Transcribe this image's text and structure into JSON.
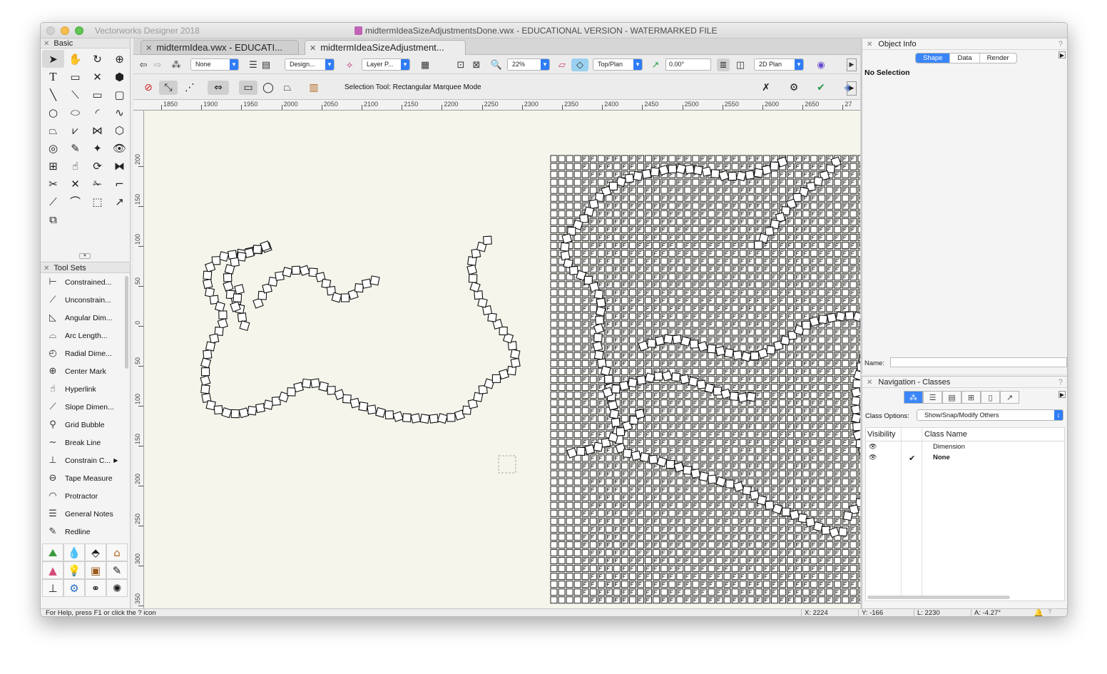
{
  "app": {
    "name": "Vectorworks Designer 2018",
    "document_title": "midtermIdeaSizeAdjustmentsDone.vwx - EDUCATIONAL VERSION - WATERMARKED FILE"
  },
  "tabs": [
    {
      "label": "midtermIdea.vwx - EDUCATI...",
      "active": false
    },
    {
      "label": "midtermIdeaSizeAdjustment...",
      "active": true
    }
  ],
  "basic_palette": {
    "title": "Basic",
    "tools": [
      "selection-icon",
      "pan-icon",
      "flyover-icon",
      "zoom-icon",
      "text-icon",
      "callout-icon",
      "locus-icon",
      "push-pull-icon",
      "line-icon",
      "double-line-icon",
      "rectangle-icon",
      "rounded-rectangle-icon",
      "circle-icon",
      "oval-icon",
      "arc-icon",
      "freehand-icon",
      "polygon-icon",
      "double-polygon-icon",
      "polyline-icon",
      "regular-polygon-icon",
      "spiral-icon",
      "eyedropper-icon",
      "wand-icon",
      "visibility-icon",
      "attribute-mapping-icon",
      "reshape-icon",
      "rotate-icon",
      "mirror-icon",
      "split-icon",
      "clip-icon",
      "trim-icon",
      "fillet-icon",
      "chamfer-icon",
      "connect-icon",
      "offset-icon",
      "move-by-points-icon",
      "clamp-icon"
    ]
  },
  "tool_sets": {
    "title": "Tool Sets",
    "items": [
      {
        "label": "Constrained...",
        "icon": "constrained-dim-icon"
      },
      {
        "label": "Unconstrain...",
        "icon": "unconstrained-dim-icon"
      },
      {
        "label": "Angular Dim...",
        "icon": "angular-dim-icon"
      },
      {
        "label": "Arc Length...",
        "icon": "arc-length-icon"
      },
      {
        "label": "Radial Dime...",
        "icon": "radial-dim-icon"
      },
      {
        "label": "Center Mark",
        "icon": "center-mark-icon"
      },
      {
        "label": "Hyperlink",
        "icon": "hyperlink-icon"
      },
      {
        "label": "Slope Dimen...",
        "icon": "slope-dim-icon"
      },
      {
        "label": "Grid Bubble",
        "icon": "grid-bubble-icon"
      },
      {
        "label": "Break Line",
        "icon": "break-line-icon"
      },
      {
        "label": "Constrain C...",
        "icon": "constrain-coincident-icon"
      },
      {
        "label": "Tape Measure",
        "icon": "tape-measure-icon"
      },
      {
        "label": "Protractor",
        "icon": "protractor-icon"
      },
      {
        "label": "General Notes",
        "icon": "general-notes-icon"
      },
      {
        "label": "Redline",
        "icon": "redline-icon"
      }
    ],
    "set_buttons": [
      "site-planning-icon",
      "landscape-icon",
      "building-shell-icon",
      "building-icon",
      "visualization-icon",
      "lighting-icon",
      "furniture-icon",
      "dims-notes-icon",
      "detailing-icon",
      "machine-design-icon",
      "fasteners-icon",
      "gears-icon"
    ]
  },
  "view_bar": {
    "class_value": "None",
    "design_layer": "Design...",
    "layer_plane": "Layer P...",
    "zoom": "22%",
    "view": "Top/Plan",
    "rotation": "0.00°",
    "render_mode": "2D Plan"
  },
  "mode_bar": {
    "status": "Selection Tool: Rectangular Marquee Mode"
  },
  "ruler": {
    "top_labels": [
      "1850",
      "1900",
      "1950",
      "2000",
      "2050",
      "2100",
      "2150",
      "2200",
      "2250",
      "2300",
      "2350",
      "2400",
      "2450",
      "2500",
      "2550",
      "2600",
      "2650",
      "27"
    ],
    "left_labels": [
      "200",
      "150",
      "100",
      "50",
      "0",
      "50",
      "100",
      "150",
      "200",
      "250",
      "300",
      "350"
    ]
  },
  "object_info": {
    "title": "Object Info",
    "tabs": [
      "Shape",
      "Data",
      "Render"
    ],
    "active_tab": "Shape",
    "selection": "No Selection",
    "name_label": "Name:",
    "name_value": ""
  },
  "navigation": {
    "title": "Navigation - Classes",
    "class_options_label": "Class Options:",
    "class_options_value": "Show/Snap/Modify Others",
    "columns": [
      "Visibility",
      "Class Name"
    ],
    "rows": [
      {
        "name": "Dimension",
        "active": false
      },
      {
        "name": "None",
        "active": true
      }
    ]
  },
  "status_bar": {
    "help": "For Help, press F1 or click the ? icon",
    "x": "X:  2224",
    "y": "Y:  -166",
    "l": "L:  2230",
    "a": "A:  -4.27°"
  },
  "colors": {
    "accent": "#3a86f8",
    "drawing_bg": "#f6f5ec"
  }
}
